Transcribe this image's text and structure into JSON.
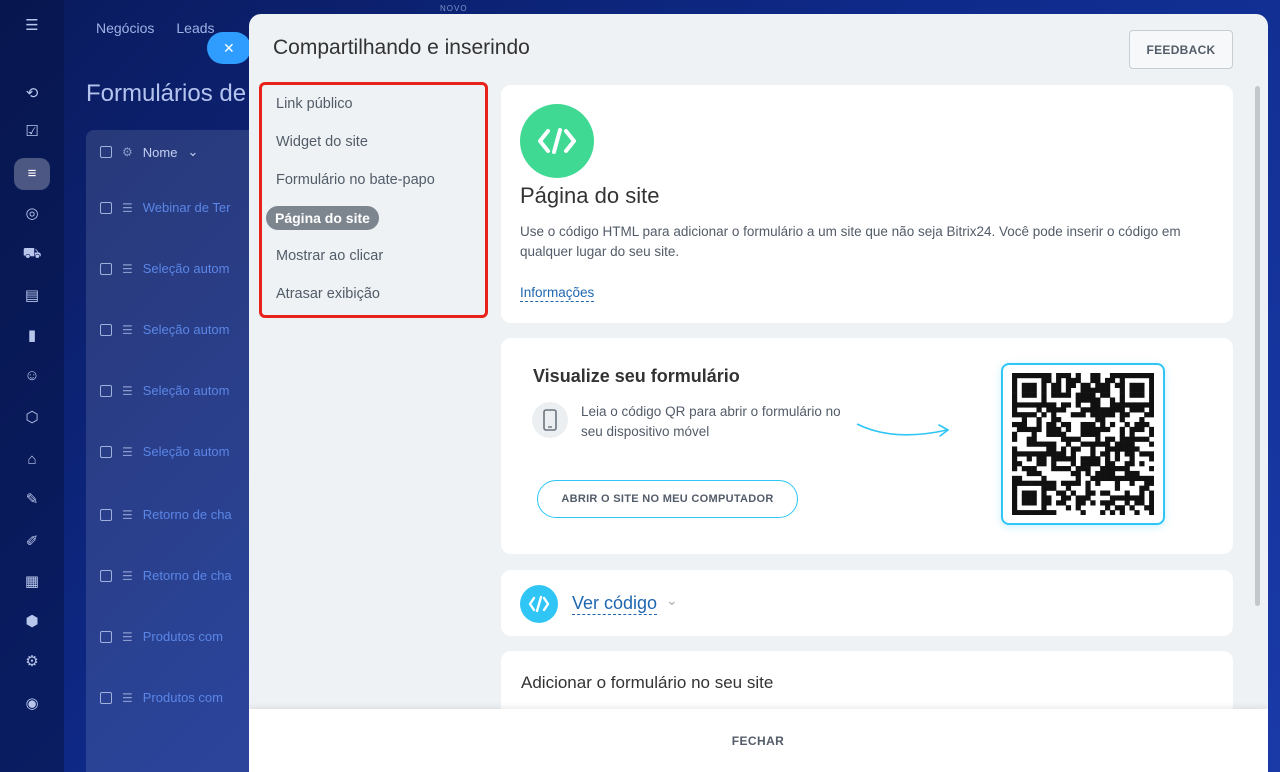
{
  "background": {
    "top_nav": [
      "Negócios",
      "Leads",
      ""
    ],
    "novo_badge": "NOVO",
    "page_title": "Formulários de",
    "close_bubble_icon": "close-icon",
    "table_header": "Nome",
    "rows": [
      "Webinar de Ter",
      "Seleção autom",
      "Seleção autom",
      "Seleção autom",
      "Seleção autom",
      "Retorno de cha",
      "Retorno de cha",
      "Produtos com",
      "Produtos com"
    ],
    "rail_icons": [
      "menu-icon",
      "crm-icon",
      "tasks-icon",
      "forms-icon",
      "marketing-icon",
      "cart-icon",
      "contact-card-icon",
      "analytics-icon",
      "robot-icon",
      "package-icon",
      "warehouse-icon",
      "sign-icon",
      "edit-doc-icon",
      "calendar-icon",
      "hex-icon",
      "gear-icon",
      "settings-icon"
    ]
  },
  "panel": {
    "title": "Compartilhando e inserindo",
    "feedback_label": "FEEDBACK",
    "menu": [
      {
        "label": "Link público"
      },
      {
        "label": "Widget do site"
      },
      {
        "label": "Formulário no bate-papo"
      },
      {
        "label": "Página do site",
        "active": true
      },
      {
        "label": "Mostrar ao clicar"
      },
      {
        "label": "Atrasar exibição"
      }
    ],
    "site_page": {
      "icon": "code-icon",
      "title": "Página do site",
      "description": "Use o código HTML para adicionar o formulário a um site que não seja Bitrix24. Você pode inserir o código em qualquer lugar do seu site.",
      "info_link": "Informações"
    },
    "preview": {
      "title": "Visualize seu formulário",
      "qr_text": "Leia o código QR para abrir o formulário no seu dispositivo móvel",
      "open_button": "ABRIR O SITE NO MEU COMPUTADOR",
      "phone_icon": "phone-icon"
    },
    "view_code": {
      "label": "Ver código",
      "icon": "code-icon"
    },
    "add_form": {
      "title": "Adicionar o formulário no seu site"
    },
    "close_label": "FECHAR"
  },
  "colors": {
    "accent_green": "#3fd994",
    "accent_blue": "#2fc6f6",
    "link_blue": "#2067b0",
    "highlight_red": "#e8221b",
    "active_pill": "#7d858f"
  }
}
